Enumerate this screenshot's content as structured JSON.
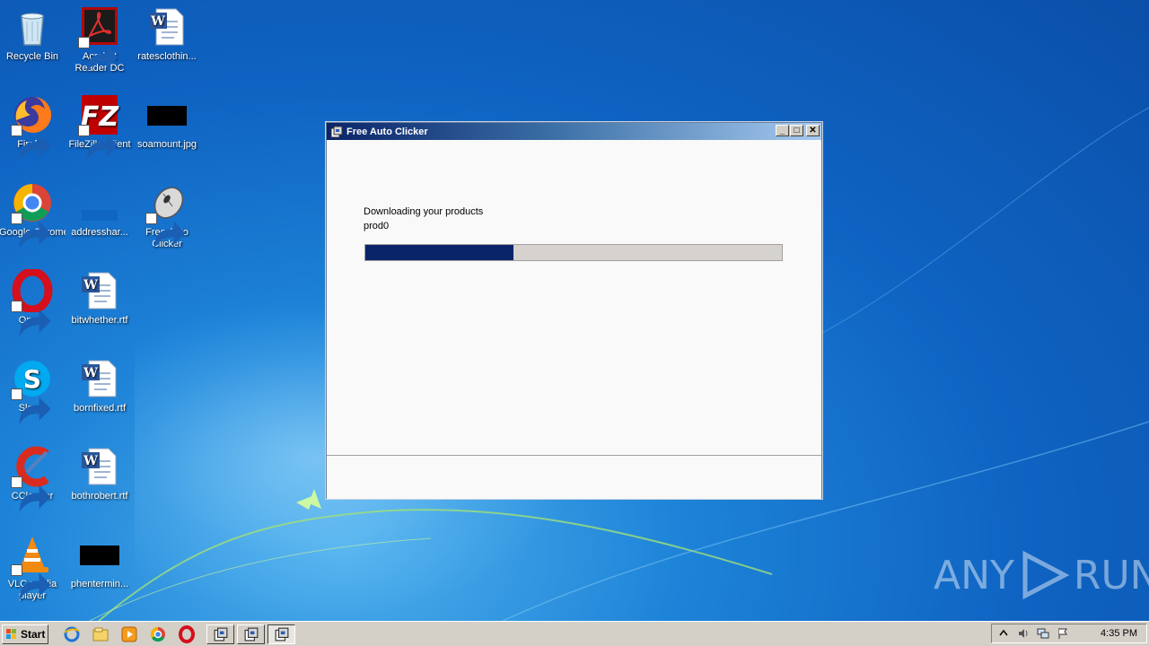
{
  "desktop": {
    "icons": [
      {
        "label": "Recycle Bin",
        "icon": "recycle-bin-icon"
      },
      {
        "label": "Acrobat Reader DC",
        "icon": "acrobat-icon"
      },
      {
        "label": "ratesclothin...",
        "icon": "word-doc-icon"
      },
      {
        "label": "Firefox",
        "icon": "firefox-icon"
      },
      {
        "label": "FileZilla Client",
        "icon": "filezilla-icon"
      },
      {
        "label": "soamount.jpg",
        "icon": "image-thumbnail-icon"
      },
      {
        "label": "Google Chrome",
        "icon": "chrome-icon"
      },
      {
        "label": "addresshar...",
        "icon": "blank-file-icon"
      },
      {
        "label": "Free Auto Clicker",
        "icon": "mouse-icon"
      },
      {
        "label": "Opera",
        "icon": "opera-icon"
      },
      {
        "label": "bitwhether.rtf",
        "icon": "word-doc-icon"
      },
      {
        "label": "Skype",
        "icon": "skype-icon"
      },
      {
        "label": "bornfixed.rtf",
        "icon": "word-doc-icon"
      },
      {
        "label": "CCleaner",
        "icon": "ccleaner-icon"
      },
      {
        "label": "bothrobert.rtf",
        "icon": "word-doc-icon"
      },
      {
        "label": "VLC media player",
        "icon": "vlc-icon"
      },
      {
        "label": "phentermin...",
        "icon": "image-thumbnail-icon"
      }
    ]
  },
  "window": {
    "title": "Free Auto Clicker",
    "status_line_1": "Downloading your products",
    "status_line_2": "prod0",
    "progress": 0.355,
    "progress_color": "#0a246a"
  },
  "taskbar": {
    "start_label": "Start",
    "clock": "4:35 PM"
  },
  "watermark": {
    "left": "ANY",
    "right": "RUN"
  }
}
